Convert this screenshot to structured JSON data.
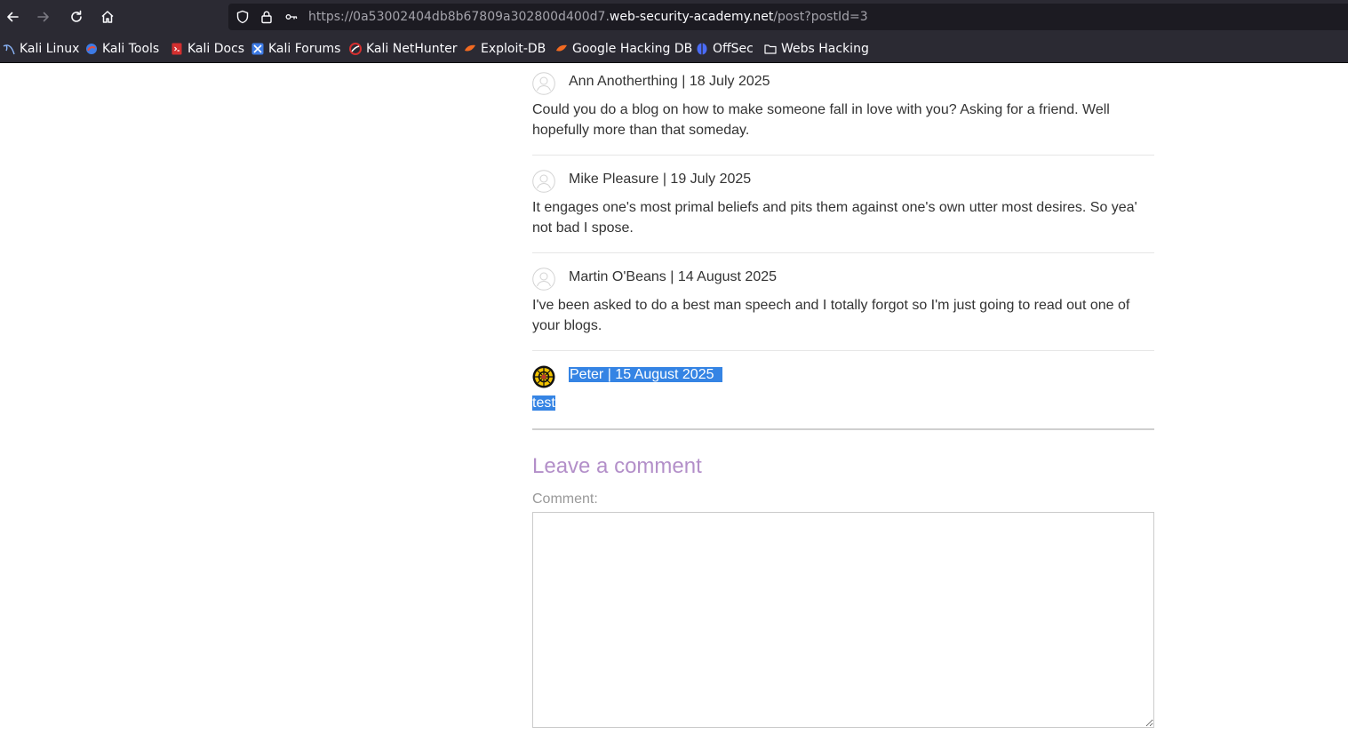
{
  "browser": {
    "url": {
      "prefix": "https://0a53002404db8b67809a302800d400d7.",
      "host": "web-security-academy.net",
      "path": "/post?postId=3"
    },
    "bookmarks": [
      {
        "label": "Kali Linux",
        "icon": "kali-dragon-icon",
        "color": "#8ab4f8"
      },
      {
        "label": "Kali Tools",
        "icon": "kali-tools-icon",
        "color": "#e44d3a"
      },
      {
        "label": "Kali Docs",
        "icon": "kali-docs-icon",
        "color": "#d32f2f"
      },
      {
        "label": "Kali Forums",
        "icon": "kali-forums-icon",
        "color": "#3d7be5"
      },
      {
        "label": "Kali NetHunter",
        "icon": "kali-nethunter-icon",
        "color": "#d32f2f"
      },
      {
        "label": "Exploit-DB",
        "icon": "exploit-db-icon",
        "color": "#f26a21"
      },
      {
        "label": "Google Hacking DB",
        "icon": "ghdb-icon",
        "color": "#f26a21"
      },
      {
        "label": "OffSec",
        "icon": "offsec-icon",
        "color": "#4a6cf7"
      },
      {
        "label": "Webs Hacking",
        "icon": "folder-icon",
        "color": "#fbfbfe"
      }
    ]
  },
  "comments": [
    {
      "author_line": "Ann Anotherthing | 18 July 2025",
      "text": "Could you do a blog on how to make someone fall in love with you? Asking for a friend. Well hopefully more than that someday."
    },
    {
      "author_line": "Mike Pleasure | 19 July 2025",
      "text": "It engages one's most primal beliefs and pits them against one's own utter most desires. So yea' not bad I spose."
    },
    {
      "author_line": "Martin O'Beans | 14 August 2025",
      "text": "I've been asked to do a best man speech and I totally forgot so I'm just going to read out one of your blogs."
    },
    {
      "author_line": "Peter | 15 August 2025",
      "text": "test"
    }
  ],
  "leave_comment": {
    "title": "Leave a comment",
    "comment_label": "Comment:",
    "comment_value": ""
  },
  "colors": {
    "selection": "#3584e4",
    "heading_accent": "#b38fc9",
    "chrome_bg": "#2b2a33"
  }
}
